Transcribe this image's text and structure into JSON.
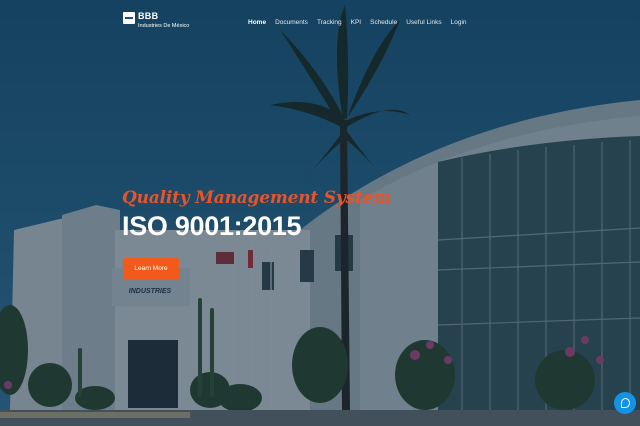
{
  "brand": {
    "name": "BBB",
    "subtitle": "Industries De México"
  },
  "nav": {
    "items": [
      {
        "label": "Home",
        "active": true
      },
      {
        "label": "Documents",
        "active": false
      },
      {
        "label": "Tracking",
        "active": false
      },
      {
        "label": "KPI",
        "active": false
      },
      {
        "label": "Schedule",
        "active": false
      },
      {
        "label": "Useful Links",
        "active": false
      },
      {
        "label": "Login",
        "active": false
      }
    ]
  },
  "hero": {
    "subtitle": "Quality Management System",
    "title": "ISO 9001:2015",
    "cta_label": "Learn More",
    "building_sign": "INDUSTRIES"
  },
  "colors": {
    "accent": "#f25a1c",
    "subtitle": "#e8542a",
    "sky": "#1d4258",
    "chat": "#1493e6"
  },
  "icons": {
    "chat": "chat-icon",
    "logo": "brand-logo-icon"
  }
}
